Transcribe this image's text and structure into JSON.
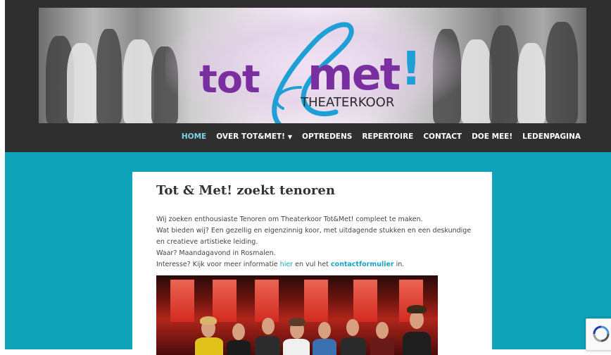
{
  "header": {
    "logo": {
      "word1": "tot",
      "word2": "met",
      "exclaim": "!",
      "subtitle": "THEATERKOOR"
    },
    "nav": [
      {
        "label": "HOME",
        "active": true
      },
      {
        "label": "OVER TOT&MET!",
        "has_dropdown": true
      },
      {
        "label": "OPTREDENS"
      },
      {
        "label": "REPERTOIRE"
      },
      {
        "label": "CONTACT"
      },
      {
        "label": "DOE MEE!"
      },
      {
        "label": "LEDENPAGINA"
      }
    ]
  },
  "post": {
    "title": "Tot & Met! zoekt tenoren",
    "lines": [
      "Wij zoeken enthousiaste Tenoren om Theaterkoor Tot&Met! compleet te maken.",
      "Wat bieden wij? Een gezellig en eigenzinnig koor, met uitdagende stukken en een deskundige en creatieve artistieke leiding.",
      "Waar? Maandagavond in Rosmalen."
    ],
    "interest": {
      "prefix": "Interesse? Kijk voor meer informatie ",
      "link1": "hier",
      "middle": " en vul het ",
      "link2": "contactformulier",
      "suffix": " in."
    }
  },
  "colors": {
    "header_bg": "#2f2f2f",
    "main_bg": "#0ea3b8",
    "nav_active": "#7fd3e6",
    "logo_purple": "#7a2fa0",
    "logo_blue": "#1ea0d6",
    "link": "#1aa2c2"
  },
  "icons": {
    "dropdown": "caret-down-icon",
    "captcha": "recaptcha-icon"
  }
}
